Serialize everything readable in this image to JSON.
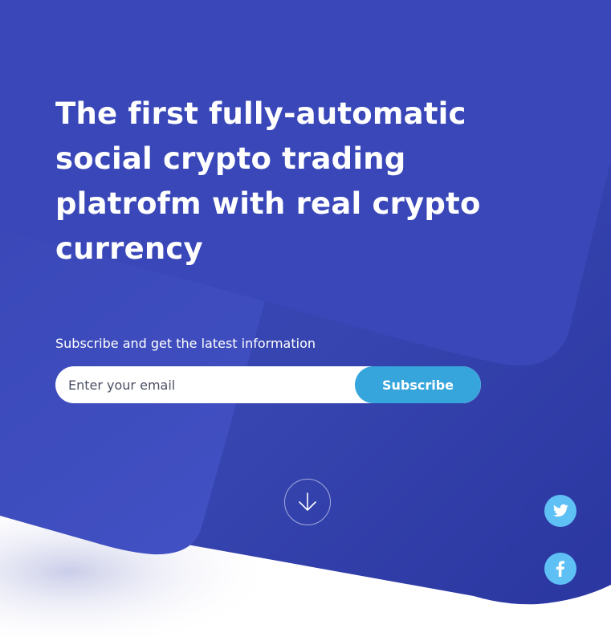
{
  "hero": {
    "title": "The first fully-automatic social crypto trading platrofm with real crypto currency"
  },
  "subscribe": {
    "subtitle": "Subscribe and get the latest information",
    "email_placeholder": "Enter your email",
    "button_label": "Subscribe"
  },
  "icons": {
    "scroll_down": "arrow-down-icon",
    "twitter": "twitter-icon",
    "facebook": "facebook-icon"
  },
  "colors": {
    "background_primary": "#3947b8",
    "background_dark": "#2e3aa0",
    "button_accent": "#35a5dc",
    "social_icon_bg": "#5fc0f5",
    "text": "#ffffff"
  }
}
